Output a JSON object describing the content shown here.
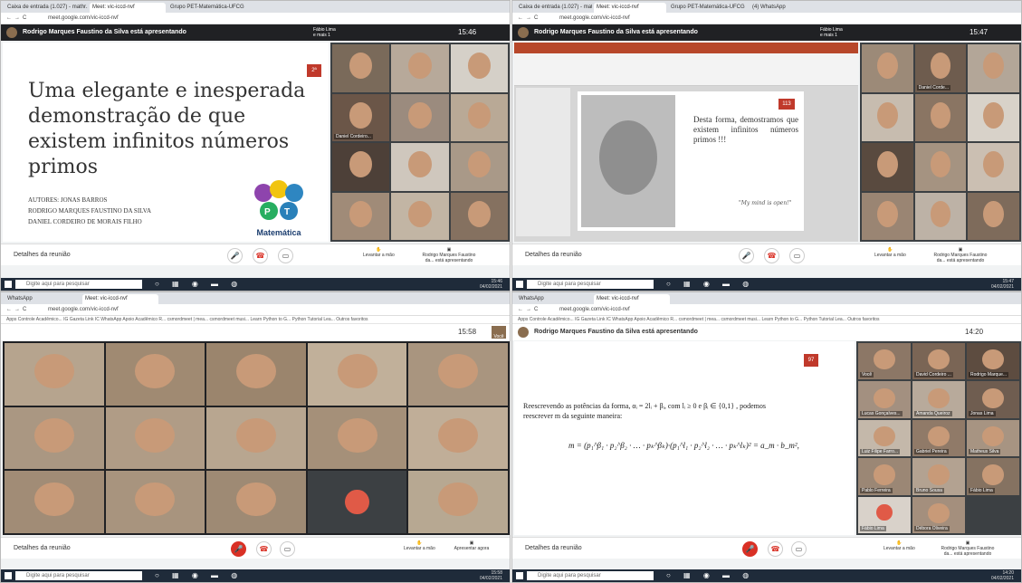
{
  "panels": [
    {
      "tabs": [
        "Caixa de entrada (1.027) - mathr...",
        "Meet: vic-iccd-nvf",
        "Grupo PET-Matemática-UFCG"
      ],
      "url": "meet.google.com/vic-iccd-nvf",
      "presenter": "Rodrigo Marques Faustino da Silva está apresentando",
      "others": "Fábio Lima\ne mais 1",
      "clock": "15:46",
      "slide_num": "2ª",
      "title": "Uma elegante e inesperada demonstração de que existem infinitos números primos",
      "authors": [
        "AUTORES: JONAS BARROS",
        "RODRIGO MARQUES FAUSTINO DA SILVA",
        "DANIEL CORDEIRO DE MORAIS FILHO"
      ],
      "logo": "Matemática",
      "tile_names": [
        "",
        "",
        "",
        "Daniel Cordeiro...",
        "",
        "",
        "",
        "",
        "",
        "",
        ""
      ],
      "details": "Detalhes da reunião",
      "raise": "Levantar a mão",
      "present_label": "Rodrigo Marques Faustino da... está apresentando",
      "search": "Digite aqui para pesquisar",
      "tray_time": "15:46",
      "tray_date": "04/02/2021",
      "tray_lang": "POR PTB2"
    },
    {
      "tabs": [
        "Caixa de entrada (1.027) - math...",
        "Meet: vic-iccd-nvf",
        "Grupo PET-Matemática-UFCG",
        "(4) WhatsApp"
      ],
      "url": "meet.google.com/vic-iccd-nvf",
      "presenter": "Rodrigo Marques Faustino da Silva está apresentando",
      "others": "Fábio Lima\ne mais 1",
      "clock": "15:47",
      "slide_num": "113",
      "slide_text": "Desta forma, demostramos que existem infinitos números primos !!!",
      "quote": "\"My mind is open!\"",
      "tile_names": [
        "",
        "Daniel Corde...",
        "",
        "",
        "",
        "",
        "",
        "",
        "",
        "",
        ""
      ],
      "details": "Detalhes da reunião",
      "raise": "Levantar a mão",
      "present_label": "Rodrigo Marques Faustino da... está apresentando",
      "search": "Digite aqui para pesquisar",
      "tray_time": "15:47",
      "tray_date": "04/02/2021",
      "tray_lang": "POR PTB2"
    },
    {
      "tabs": [
        "WhatsApp",
        "Meet: vic-iccd-nvf"
      ],
      "url": "meet.google.com/vic-iccd-nvf",
      "bookmarks": "Apps   Controle Acadêmico...   IG Gazeta   Link IC   WhatsApp   Apoio Acadêmico R...   csmordmeet | mea...   csmordmeet musi...   Learn Python to G...   Python Tutorial Lea...   Outros favoritos",
      "clock": "15:58",
      "self_label": "Você",
      "details": "Detalhes da reunião",
      "raise": "Levantar a mão",
      "present_now": "Apresentar agora",
      "search": "Digite aqui para pesquisar",
      "tray_time": "15:58",
      "tray_date": "04/02/2021"
    },
    {
      "tabs": [
        "WhatsApp",
        "Meet: vic-iccd-nvf"
      ],
      "url": "meet.google.com/vic-iccd-nvf",
      "bookmarks": "Apps   Controle Acadêmico...   IG Gazeta   Link IC   WhatsApp   Apoio Acadêmico R...   csmordmeet | mea...   csmordmeet musi...   Learn Python to G...   Python Tutorial Lea...   Outros favoritos",
      "presenter": "Rodrigo Marques Faustino da Silva está apresentando",
      "clock": "14:20",
      "slide_num": "97",
      "math_line1": "Reescrevendo as potências da forma, αᵢ = 2lᵢ + βᵢ, com lᵢ ≥ 0 e βᵢ ∈ {0,1} , podemos",
      "math_line2": "reescrever m da seguinte maneira:",
      "equation": "m = (p₁^β₁ · p₂^β₂ · … · pₖ^βₖ)·(p₁^l₁ · p₂^l₂ · … · pₖ^lₖ)² = a_m · b_m²,",
      "tile_names": [
        "Você",
        "David Cordeiro ...",
        "Rodrigo Marque...",
        "Lucas Gonçalves...",
        "Amanda Queiroz",
        "Jonas Lima",
        "Luiz Filipe Farro...",
        "Gabriel Pereira",
        "Matheus Silva",
        "Pablo Ferreira",
        "Bruno Sousa",
        "Fábio Lima",
        "Fábio Lima",
        "Débora Oliveira"
      ],
      "details": "Detalhes da reunião",
      "raise": "Levantar a mão",
      "present_label": "Rodrigo Marques Faustino da... está apresentando",
      "search": "Digite aqui para pesquisar",
      "tray_time": "14:20",
      "tray_date": "04/02/2021"
    }
  ]
}
